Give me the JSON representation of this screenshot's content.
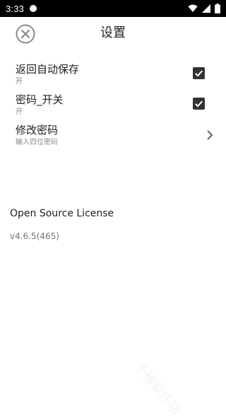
{
  "status_bar": {
    "time": "3:33"
  },
  "toolbar": {
    "title": "设置"
  },
  "settings": [
    {
      "title": "返回自动保存",
      "summary": "开",
      "checked": true
    },
    {
      "title": "密码_开关",
      "summary": "开",
      "checked": true
    },
    {
      "title": "修改密码",
      "summary": "输入四位密码"
    }
  ],
  "about": {
    "license": "Open Source License",
    "version": "v4.6.5(465)"
  },
  "watermark": "千禧软件站",
  "colors": {
    "status_bar": "#000000",
    "checkbox": "#323232",
    "summary_text": "#8a8a8a"
  }
}
